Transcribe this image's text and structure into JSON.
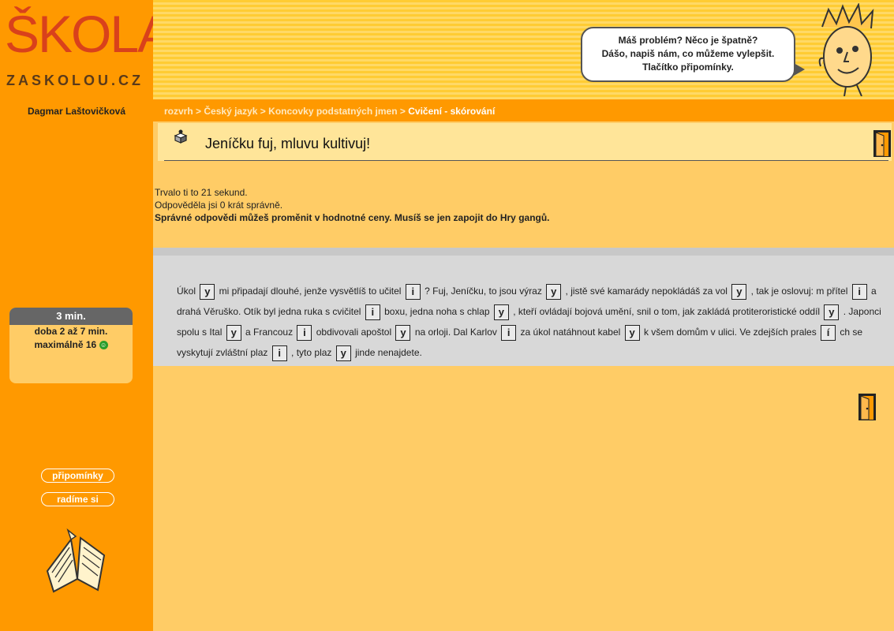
{
  "logo": {
    "main": "ŠKOLA",
    "sub": "ZASKOLOU.CZ"
  },
  "feedback_bubble": {
    "line1": "Máš problém? Něco je špatně?",
    "line2": "Dášo, napiš nám, co můžeme vylepšit.",
    "line3": "Tlačítko připomínky."
  },
  "user": {
    "name": "Dagmar Laštovičková"
  },
  "breadcrumb": {
    "items": [
      "rozvrh",
      "Český jazyk",
      "Koncovky podstatných jmen"
    ],
    "separator": ">",
    "current": "Cvičení - skórování"
  },
  "exercise_title": "Jeníčku fuj, mluvu kultivuj!",
  "results": {
    "time": "Trvalo ti to 21 sekund.",
    "correct": "Odpověděla jsi 0 krát správně.",
    "bonus": "Správné odpovědi můžeš proměnit v hodnotné ceny. Musíš se jen zapojit do Hry gangů."
  },
  "timer": {
    "current": "3 min.",
    "range": "doba 2 až 7 min.",
    "max": "maximálně 16"
  },
  "sidebar_buttons": {
    "feedback": "připomínky",
    "advice": "radíme si"
  },
  "exercise_segments": [
    {
      "t": "Úkol "
    },
    {
      "g": "y"
    },
    {
      "t": " mi připadají dlouhé, jenže vysvětlíš to učitel "
    },
    {
      "g": "i"
    },
    {
      "t": " ? Fuj, Jeníčku, to jsou výraz "
    },
    {
      "g": "y"
    },
    {
      "t": " , jistě své kamarády nepokládáš za vol "
    },
    {
      "g": "y"
    },
    {
      "t": " , tak je oslovuj: m přítel "
    },
    {
      "g": "i"
    },
    {
      "t": " a drahá Věruško. Otík byl jedna ruka s cvičitel "
    },
    {
      "g": "i"
    },
    {
      "t": " boxu, jedna noha s chlap "
    },
    {
      "g": "y"
    },
    {
      "t": " , kteří ovládají bojová umění, snil o tom, jak zakládá protiteroristické oddíl "
    },
    {
      "g": "y"
    },
    {
      "t": " . Japonci spolu s Ital "
    },
    {
      "g": "y"
    },
    {
      "t": " a Francouz "
    },
    {
      "g": "i"
    },
    {
      "t": " obdivovali apoštol "
    },
    {
      "g": "y"
    },
    {
      "t": " na orloji. Dal Karlov "
    },
    {
      "g": "i"
    },
    {
      "t": " za úkol natáhnout kabel "
    },
    {
      "g": "y"
    },
    {
      "t": " k všem domům v ulici. Ve zdejších prales "
    },
    {
      "g": "í"
    },
    {
      "t": " ch se vyskytují zvláštní plaz "
    },
    {
      "g": "i"
    },
    {
      "t": " , tyto plaz "
    },
    {
      "g": "y"
    },
    {
      "t": " jinde nenajdete."
    }
  ],
  "colors": {
    "background": "#ffcc66",
    "sidebar": "#ff9900",
    "logo_red": "#d9411b",
    "exercise_bg": "#d8d8d8",
    "timer_header": "#666666"
  },
  "icons": [
    "tutor-mascot-icon",
    "exercise-icon",
    "exit-door-icon",
    "open-book-icon",
    "smile-icon"
  ]
}
